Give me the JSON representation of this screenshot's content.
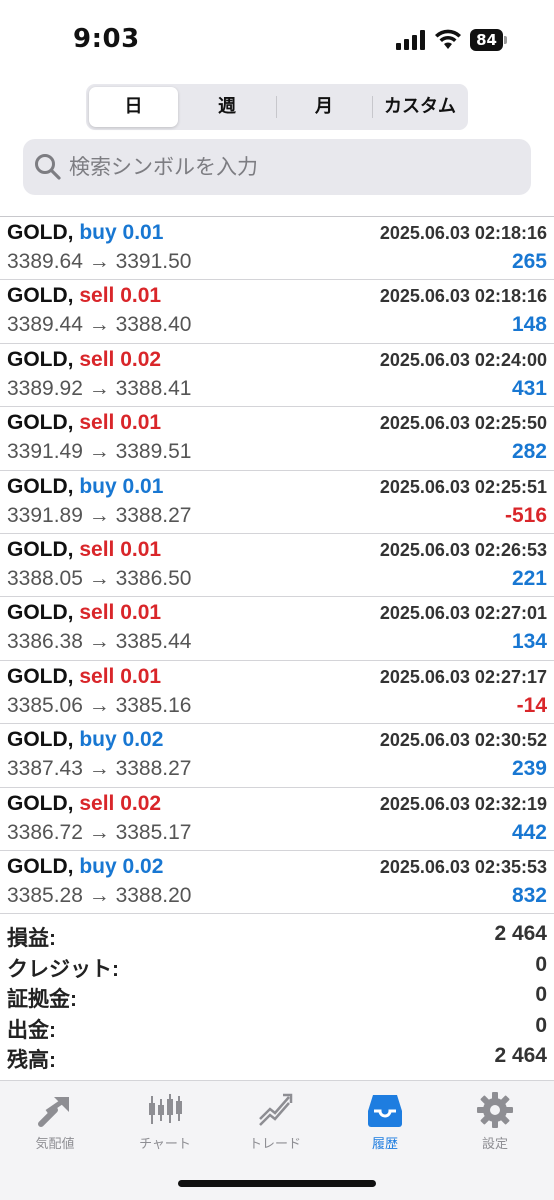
{
  "status_bar": {
    "time": "9:03",
    "battery_level": "84"
  },
  "segmented": {
    "items": [
      "日",
      "週",
      "月",
      "カスタム"
    ],
    "selected_index": 0
  },
  "search": {
    "placeholder": "検索シンボルを入力"
  },
  "trades": [
    {
      "symbol": "GOLD,",
      "side": "buy 0.01",
      "type": "buy",
      "time": "2025.06.03 02:18:16",
      "prices": "3389.64 → 3391.50",
      "profit": "265"
    },
    {
      "symbol": "GOLD,",
      "side": "sell 0.01",
      "type": "sell",
      "time": "2025.06.03 02:18:16",
      "prices": "3389.44 → 3388.40",
      "profit": "148"
    },
    {
      "symbol": "GOLD,",
      "side": "sell 0.02",
      "type": "sell",
      "time": "2025.06.03 02:24:00",
      "prices": "3389.92 → 3388.41",
      "profit": "431"
    },
    {
      "symbol": "GOLD,",
      "side": "sell 0.01",
      "type": "sell",
      "time": "2025.06.03 02:25:50",
      "prices": "3391.49 → 3389.51",
      "profit": "282"
    },
    {
      "symbol": "GOLD,",
      "side": "buy 0.01",
      "type": "buy",
      "time": "2025.06.03 02:25:51",
      "prices": "3391.89 → 3388.27",
      "profit": "-516"
    },
    {
      "symbol": "GOLD,",
      "side": "sell 0.01",
      "type": "sell",
      "time": "2025.06.03 02:26:53",
      "prices": "3388.05 → 3386.50",
      "profit": "221"
    },
    {
      "symbol": "GOLD,",
      "side": "sell 0.01",
      "type": "sell",
      "time": "2025.06.03 02:27:01",
      "prices": "3386.38 → 3385.44",
      "profit": "134"
    },
    {
      "symbol": "GOLD,",
      "side": "sell 0.01",
      "type": "sell",
      "time": "2025.06.03 02:27:17",
      "prices": "3385.06 → 3385.16",
      "profit": "-14"
    },
    {
      "symbol": "GOLD,",
      "side": "buy 0.02",
      "type": "buy",
      "time": "2025.06.03 02:30:52",
      "prices": "3387.43 → 3388.27",
      "profit": "239"
    },
    {
      "symbol": "GOLD,",
      "side": "sell 0.02",
      "type": "sell",
      "time": "2025.06.03 02:32:19",
      "prices": "3386.72 → 3385.17",
      "profit": "442"
    },
    {
      "symbol": "GOLD,",
      "side": "buy 0.02",
      "type": "buy",
      "time": "2025.06.03 02:35:53",
      "prices": "3385.28 → 3388.20",
      "profit": "832"
    }
  ],
  "summary": [
    {
      "label": "損益:",
      "value": "2 464"
    },
    {
      "label": "クレジット:",
      "value": "0"
    },
    {
      "label": "証拠金:",
      "value": "0"
    },
    {
      "label": "出金:",
      "value": "0"
    },
    {
      "label": "残高:",
      "value": "2 464"
    }
  ],
  "tab_bar": {
    "items": [
      {
        "label": "気配値",
        "icon": "quotes-icon"
      },
      {
        "label": "チャート",
        "icon": "chart-icon"
      },
      {
        "label": "トレード",
        "icon": "trade-icon"
      },
      {
        "label": "履歴",
        "icon": "history-icon"
      },
      {
        "label": "設定",
        "icon": "settings-icon"
      }
    ],
    "active_index": 3
  },
  "colors": {
    "buy": "#1877d2",
    "sell": "#d9262a",
    "tab_active": "#1e7de0",
    "tab_inactive": "#8e8e93"
  }
}
